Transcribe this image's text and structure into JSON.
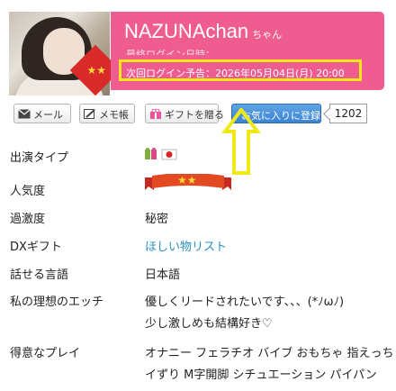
{
  "header": {
    "name": "NAZUNAchan",
    "honorific": "ちゃん",
    "last_login": "最終ログイン日時：",
    "next_login": "次回ログイン予告：2026年05月04日(月) 20:00",
    "photo_badge": "★★"
  },
  "buttons": {
    "mail": "メール",
    "memo": "メモ帳",
    "gift": "ギフトを贈る",
    "favorite": "お気に入りに登録",
    "favorite_count": "1202"
  },
  "profile": {
    "performance_type": {
      "label": "出演タイプ"
    },
    "popularity": {
      "label": "人気度",
      "stars": "★★"
    },
    "intensity": {
      "label": "過激度",
      "value": "秘密"
    },
    "dx_gift": {
      "label": "DXギフト",
      "value": "ほしい物リスト"
    },
    "languages": {
      "label": "話せる言語",
      "value": "日本語"
    },
    "ideal": {
      "label": "私の理想のエッチ",
      "line1": "優しくリードされたいです、、、(*ﾉωﾉ)",
      "line2": "少し激しめも結構好き♡"
    },
    "play": {
      "label": "得意なプレイ",
      "line1": "オナニー フェラチオ バイブ おもちゃ 指えっち パ",
      "line2": "イずり M字開脚 シチュエーション パイパン"
    }
  },
  "colors": {
    "pink": "#ee5c90",
    "highlight": "#f1e81a",
    "fav_blue": "#3b83d1",
    "link": "#2a8fc6"
  }
}
